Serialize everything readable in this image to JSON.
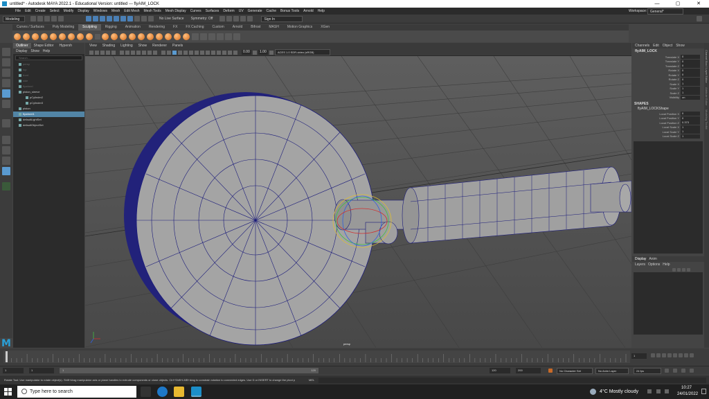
{
  "window": {
    "title": "untitled* - Autodesk MAYA 2022.1 - Educational Version: untitled   ---   flyAIM_LOCK",
    "controls": [
      "—",
      "▢",
      "✕"
    ]
  },
  "menubar": {
    "items": [
      "File",
      "Edit",
      "Create",
      "Select",
      "Modify",
      "Display",
      "Windows",
      "Mesh",
      "Edit Mesh",
      "Mesh Tools",
      "Mesh Display",
      "Curves",
      "Surfaces",
      "Deform",
      "UV",
      "Generate",
      "Cache",
      "Bonus Tools",
      "Arnold",
      "Help"
    ],
    "workspace_label": "Workspace:",
    "workspace_value": "General*"
  },
  "statusline": {
    "mode": "Modeling",
    "no_live_surface": "No Live Surface",
    "symmetry": "Symmetry: Off",
    "sign_in": "Sign In"
  },
  "shelf": {
    "tabs": [
      "Curves / Surfaces",
      "Poly Modeling",
      "Sculpting",
      "Rigging",
      "Animation",
      "Rendering",
      "FX",
      "FX Caching",
      "Custom",
      "Arnold",
      "Bifrost",
      "MASH",
      "Motion Graphics",
      "XGen"
    ],
    "active": "Sculpting"
  },
  "outliner": {
    "tabs": [
      "Outliner",
      "Shape Editor",
      "Hypersh"
    ],
    "menu": [
      "Display",
      "Show",
      "Help"
    ],
    "search_placeholder": "Search...",
    "items": [
      {
        "label": "persp",
        "dim": true,
        "level": 0
      },
      {
        "label": "top",
        "dim": true,
        "level": 0
      },
      {
        "label": "front",
        "dim": true,
        "level": 0
      },
      {
        "label": "side",
        "dim": true,
        "level": 0
      },
      {
        "label": "flywheel",
        "dim": true,
        "level": 0
      },
      {
        "label": "piston_sleeve",
        "dim": false,
        "level": 0
      },
      {
        "label": "pCylinder2",
        "dim": false,
        "level": 1
      },
      {
        "label": "pCylinder3",
        "dim": false,
        "level": 1
      },
      {
        "label": "piston",
        "dim": false,
        "level": 0
      },
      {
        "label": "flywheel1",
        "dim": false,
        "level": 0,
        "selected": true
      },
      {
        "label": "defaultLightSet",
        "dim": false,
        "level": 0
      },
      {
        "label": "defaultObjectSet",
        "dim": false,
        "level": 0
      }
    ]
  },
  "viewport": {
    "menu": [
      "View",
      "Shading",
      "Lighting",
      "Show",
      "Renderer",
      "Panels"
    ],
    "exposure": "0.00",
    "gamma": "1.00",
    "color_space": "ACES 1.0 SDR-video (sRGB)",
    "camera_label": "persp"
  },
  "channel_box": {
    "tabs": [
      "Channels",
      "Edit",
      "Object",
      "Show"
    ],
    "object_name": "flyAIM_LOCK",
    "attributes": [
      {
        "label": "Translate X",
        "value": "0"
      },
      {
        "label": "Translate Y",
        "value": "0"
      },
      {
        "label": "Translate Z",
        "value": "0"
      },
      {
        "label": "Rotate X",
        "value": "0"
      },
      {
        "label": "Rotate Y",
        "value": "0"
      },
      {
        "label": "Rotate Z",
        "value": "0"
      },
      {
        "label": "Scale X",
        "value": "1"
      },
      {
        "label": "Scale Y",
        "value": "1"
      },
      {
        "label": "Scale Z",
        "value": "1"
      },
      {
        "label": "Visibility",
        "value": "on"
      }
    ],
    "shapes_header": "SHAPES",
    "shape_name": "flyAIM_LOCKShape",
    "shape_attributes": [
      {
        "label": "Local Position X",
        "value": "0"
      },
      {
        "label": "Local Position Y",
        "value": "0"
      },
      {
        "label": "Local Position Z",
        "value": "0.373"
      },
      {
        "label": "Local Scale X",
        "value": "1"
      },
      {
        "label": "Local Scale Y",
        "value": "1"
      },
      {
        "label": "Local Scale Z",
        "value": "1"
      }
    ]
  },
  "layers": {
    "tabs": [
      "Display",
      "Anim"
    ],
    "menu": [
      "Layers",
      "Options",
      "Help"
    ]
  },
  "right_side_tabs": [
    "Channel Box / Layer Editor",
    "Attribute Editor",
    "Modeling Toolkit"
  ],
  "timeline": {
    "current_frame": "1",
    "start": "1",
    "range_start": "1",
    "range_end_field": "120",
    "end": "120",
    "max_end": "200",
    "fps": "24 fps",
    "character_set": "No Character Set",
    "anim_layer": "No Anim Layer"
  },
  "helpline": {
    "text": "Rotate Tool: Use manipulator to rotate object(s). Shift+drag manipulator axis or plane handles to extrude components or clone objects. Ctrl+Shift+LMB+drag to constrain rotation to connected edges. Use D or INSERT to change the pivot p",
    "mode": "MEL"
  },
  "taskbar": {
    "search_placeholder": "Type here to search",
    "weather": "4°C  Mostly cloudy",
    "time": "10:27",
    "date": "24/01/2022"
  },
  "colors": {
    "selection": "#5285a6",
    "maya_blue": "#2a9fd6",
    "wire": "#1a1a7a"
  }
}
